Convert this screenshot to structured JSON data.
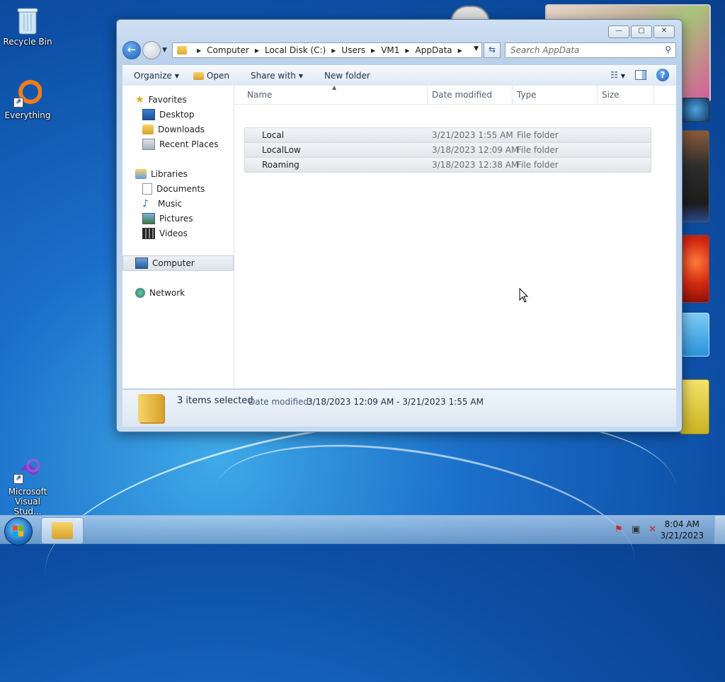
{
  "desktop": {
    "icons": [
      {
        "label": "Recycle Bin"
      },
      {
        "label": "Everything"
      },
      {
        "label": "Microsoft Visual Stud..."
      }
    ]
  },
  "window": {
    "controls": {
      "minimize": "—",
      "maximize": "▢",
      "close": "✕"
    },
    "breadcrumb": [
      "Computer",
      "Local Disk (C:)",
      "Users",
      "VM1",
      "AppData"
    ],
    "search_placeholder": "Search AppData",
    "toolbar": {
      "organize": "Organize",
      "open": "Open",
      "share_with": "Share with",
      "new_folder": "New folder"
    },
    "nav": {
      "favorites": "Favorites",
      "desktop": "Desktop",
      "downloads": "Downloads",
      "recent_places": "Recent Places",
      "libraries": "Libraries",
      "documents": "Documents",
      "music": "Music",
      "pictures": "Pictures",
      "videos": "Videos",
      "computer": "Computer",
      "network": "Network"
    },
    "columns": {
      "name": "Name",
      "date_modified": "Date modified",
      "type": "Type",
      "size": "Size"
    },
    "files": [
      {
        "name": "Local",
        "date": "3/21/2023 1:55 AM",
        "type": "File folder"
      },
      {
        "name": "LocalLow",
        "date": "3/18/2023 12:09 AM",
        "type": "File folder"
      },
      {
        "name": "Roaming",
        "date": "3/18/2023 12:38 AM",
        "type": "File folder"
      }
    ],
    "status": {
      "selected": "3 items selected",
      "date_label": "Date modified:",
      "date_range": "3/18/2023 12:09 AM - 3/21/2023 1:55 AM"
    }
  },
  "taskbar": {
    "time": "8:04 AM",
    "date": "3/21/2023"
  },
  "colors": {
    "accent": "#1e5eb8",
    "desktop": "#0d4fa6"
  }
}
